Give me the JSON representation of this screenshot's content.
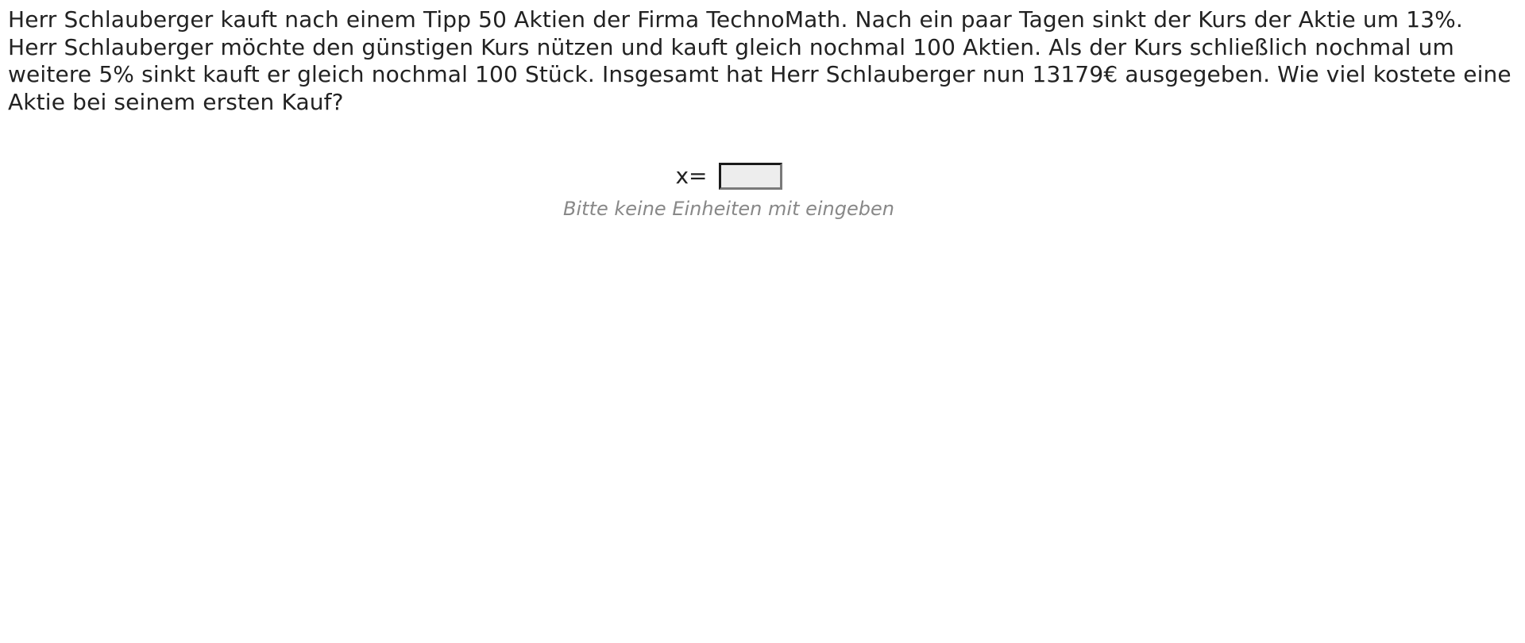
{
  "question": {
    "text": "Herr Schlauberger kauft nach einem Tipp 50 Aktien der Firma TechnoMath. Nach ein paar Tagen sinkt der Kurs der Aktie um 13%. Herr Schlauberger möchte den günstigen Kurs nützen und kauft gleich nochmal 100 Aktien. Als der Kurs schließlich nochmal um weitere 5% sinkt kauft er gleich nochmal 100 Stück. Insgesamt hat Herr Schlauberger nun 13179€ ausgegeben. Wie viel kostete eine Aktie bei seinem ersten Kauf?"
  },
  "answer": {
    "label": "x=",
    "value": "",
    "hint": "Bitte keine Einheiten mit eingeben"
  }
}
